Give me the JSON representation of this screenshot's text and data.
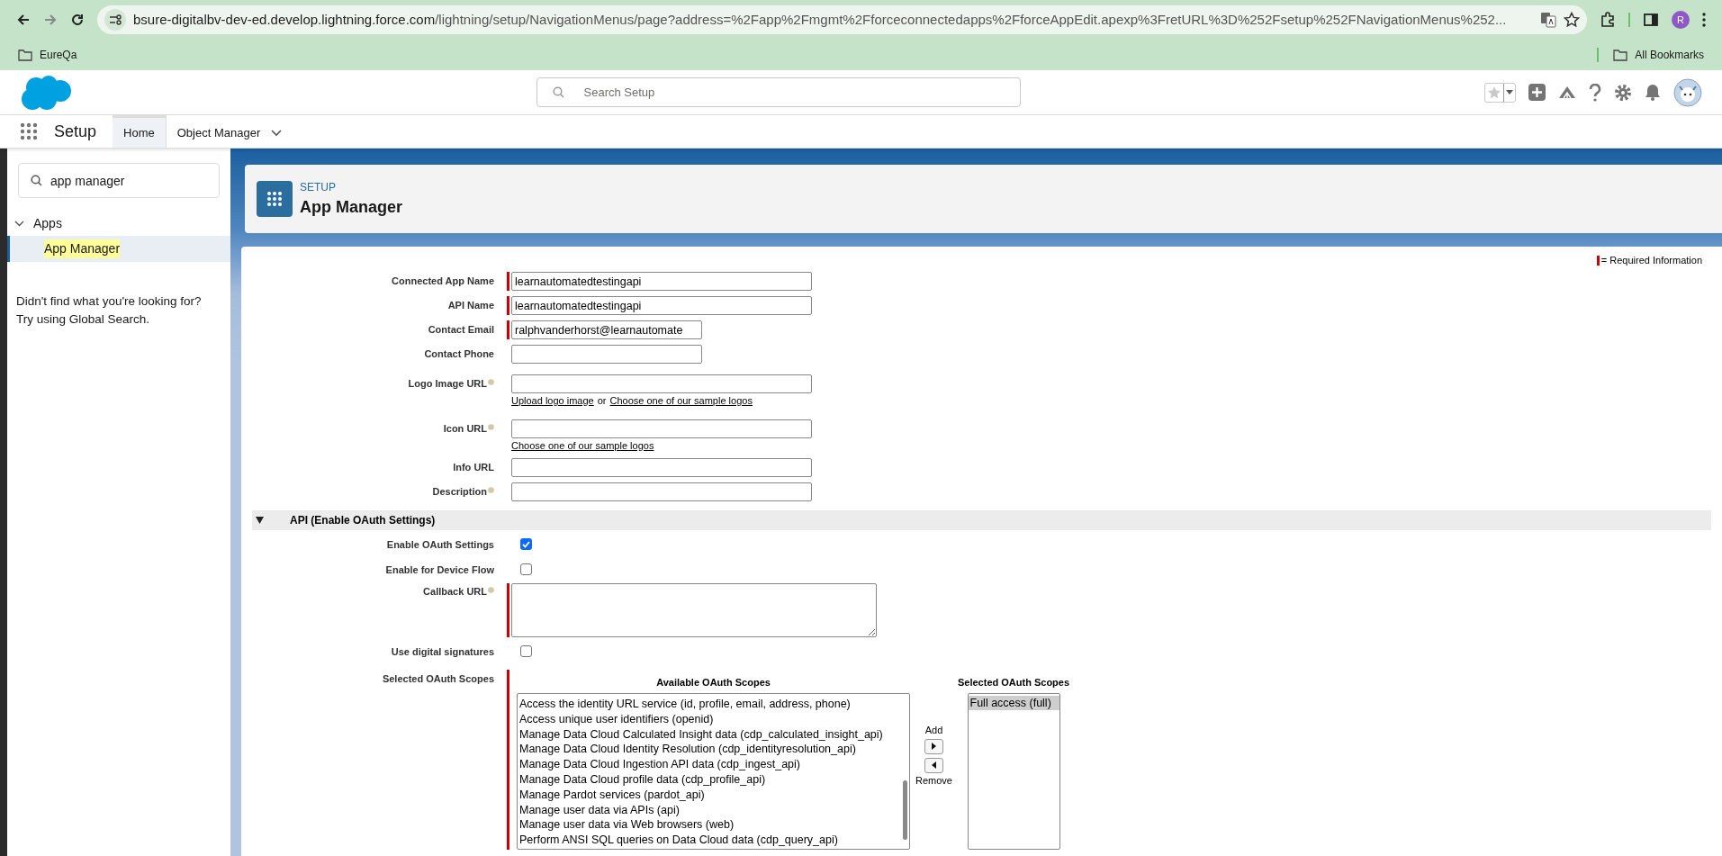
{
  "browser": {
    "url_host": "bsure-digitalbv-dev-ed.develop.lightning.force.com",
    "url_path": "/lightning/setup/NavigationMenus/page?address=%2Fapp%2Fmgmt%2Fforceconnectedapps%2FforceAppEdit.apexp%3FretURL%3D%252Fsetup%252FNavigationMenus%252...",
    "bookmarks": [
      "EureQa"
    ],
    "all_bookmarks": "All Bookmarks",
    "profile_initial": "R"
  },
  "header": {
    "search_placeholder": "Search Setup"
  },
  "nav": {
    "app_name": "Setup",
    "tabs": [
      {
        "label": "Home",
        "selected": true,
        "dropdown": false
      },
      {
        "label": "Object Manager",
        "selected": false,
        "dropdown": true
      }
    ]
  },
  "sidebar": {
    "search_value": "app manager",
    "tree": [
      {
        "label": "Apps",
        "expanded": true,
        "children": [
          {
            "label": "App Manager",
            "selected": true
          }
        ]
      }
    ],
    "help_lines": [
      "Didn't find what you're looking for?",
      "Try using Global Search."
    ]
  },
  "page_header": {
    "eyebrow": "SETUP",
    "title": "App Manager"
  },
  "form": {
    "legend": "= Required Information",
    "fields": [
      {
        "kind": "text",
        "label": "Connected App Name",
        "value": "learnautomatedtestingapi",
        "required": true,
        "help_icon": false
      },
      {
        "kind": "text",
        "label": "API Name",
        "value": "learnautomatedtestingapi",
        "required": true,
        "help_icon": false
      },
      {
        "kind": "short-text",
        "label": "Contact Email",
        "value": "ralphvanderhorst@learnautomate",
        "required": true,
        "help_icon": false
      },
      {
        "kind": "short-text",
        "label": "Contact Phone",
        "required": false,
        "help_icon": false
      },
      {
        "kind": "text",
        "label": "Logo Image URL",
        "required": false,
        "help_icon": true,
        "links": [
          {
            "kind": "link",
            "text": "Upload logo image"
          },
          {
            "kind": "text",
            "text": "or"
          },
          {
            "kind": "link",
            "text": "Choose one of our sample logos"
          }
        ]
      },
      {
        "kind": "text",
        "label": "Icon URL",
        "required": false,
        "help_icon": true,
        "links": [
          {
            "kind": "link",
            "text": "Choose one of our sample logos"
          }
        ]
      },
      {
        "kind": "text",
        "label": "Info URL",
        "required": false,
        "help_icon": false
      },
      {
        "kind": "text",
        "label": "Description",
        "required": false,
        "help_icon": true
      }
    ],
    "section": {
      "title": "API (Enable OAuth Settings)",
      "expanded": true,
      "rows": [
        {
          "kind": "checkbox",
          "label": "Enable OAuth Settings",
          "checked": true
        },
        {
          "kind": "checkbox",
          "label": "Enable for Device Flow",
          "checked": false
        },
        {
          "kind": "textarea",
          "label": "Callback URL",
          "required": true,
          "help_icon": true
        },
        {
          "kind": "checkbox",
          "label": "Use digital signatures",
          "checked": false
        },
        {
          "kind": "scopes",
          "label": "Selected OAuth Scopes",
          "required": true,
          "available_title": "Available OAuth Scopes",
          "selected_title": "Selected OAuth Scopes",
          "add_label": "Add",
          "remove_label": "Remove",
          "available": [
            {
              "label": "Access the identity URL service (id, profile, email, address, phone)",
              "selected": false
            },
            {
              "label": "Access unique user identifiers (openid)",
              "selected": false
            },
            {
              "label": "Manage Data Cloud Calculated Insight data (cdp_calculated_insight_api)",
              "selected": false
            },
            {
              "label": "Manage Data Cloud Identity Resolution (cdp_identityresolution_api)",
              "selected": false
            },
            {
              "label": "Manage Data Cloud Ingestion API data (cdp_ingest_api)",
              "selected": false
            },
            {
              "label": "Manage Data Cloud profile data (cdp_profile_api)",
              "selected": false
            },
            {
              "label": "Manage Pardot services (pardot_api)",
              "selected": false
            },
            {
              "label": "Manage user data via APIs (api)",
              "selected": false
            },
            {
              "label": "Manage user data via Web browsers (web)",
              "selected": false
            },
            {
              "label": "Perform ANSI SQL queries on Data Cloud data (cdp_query_api)",
              "selected": false
            }
          ],
          "chosen": [
            {
              "label": "Full access (full)",
              "selected": true
            }
          ]
        }
      ]
    }
  }
}
